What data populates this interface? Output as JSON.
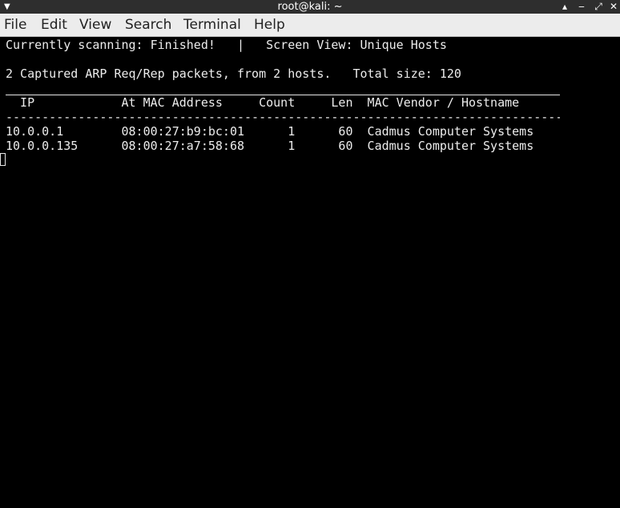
{
  "window": {
    "title": "root@kali: ~",
    "menu_icon": "triangle-down-icon",
    "controls": [
      "▴",
      "‒",
      "⤢",
      "✕"
    ]
  },
  "menubar": {
    "items": [
      "File",
      "Edit",
      "View",
      "Search",
      "Terminal",
      "Help"
    ]
  },
  "terminal": {
    "status_line": "Currently scanning: Finished!   |   Screen View: Unique Hosts",
    "summary_line": "2 Captured ARP Req/Rep packets, from 2 hosts.   Total size: 120",
    "table": {
      "header": "  IP            At MAC Address     Count     Len  MAC Vendor / Hostname",
      "separator": "-----------------------------------------------------------------------------------------",
      "rows": [
        "10.0.0.1        08:00:27:b9:bc:01      1      60  Cadmus Computer Systems",
        "10.0.0.135      08:00:27:a7:58:68      1      60  Cadmus Computer Systems"
      ]
    }
  }
}
